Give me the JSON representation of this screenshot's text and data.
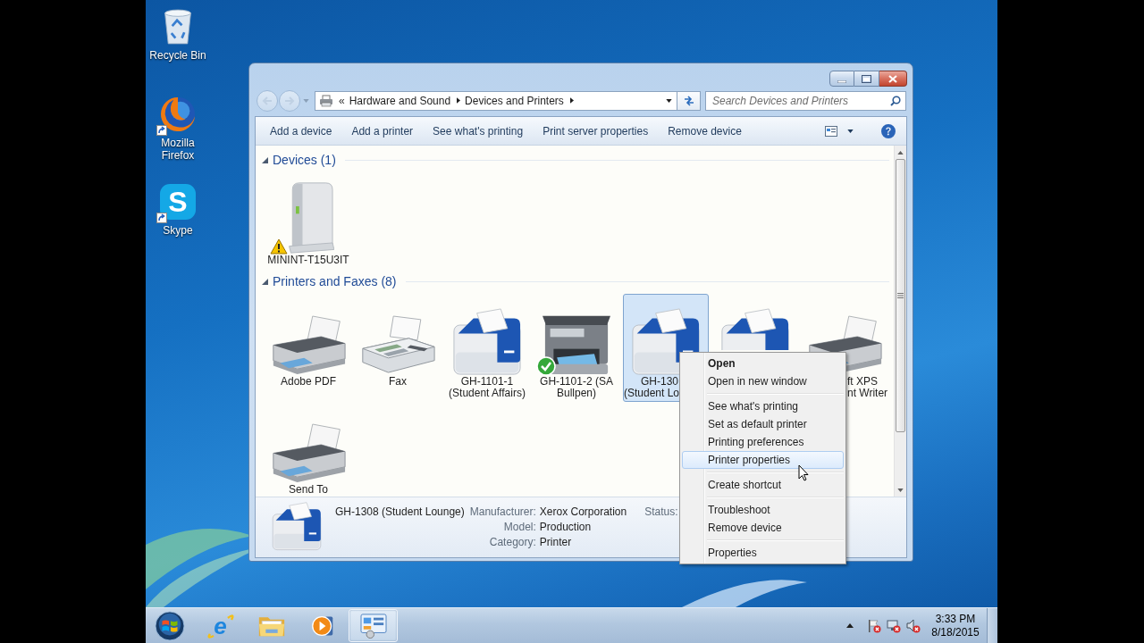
{
  "desktop_icons": [
    {
      "kind": "recycle-bin",
      "label": [
        "Recycle Bin"
      ],
      "shortcut": false
    },
    {
      "kind": "globe",
      "label": [
        "Mozilla",
        "Firefox"
      ],
      "shortcut": true
    },
    {
      "kind": "letter-tile",
      "glyph": "S",
      "label": [
        "Skype"
      ],
      "shortcut": true
    }
  ],
  "window": {
    "back": {
      "disabled": true
    },
    "forward": {
      "disabled": true
    },
    "address": {
      "overflow": "«",
      "crumbs": [
        "Hardware and Sound",
        "Devices and Printers"
      ]
    },
    "search": {
      "placeholder": "Search Devices and Printers"
    },
    "commands": [
      "Add a device",
      "Add a printer",
      "See what's printing",
      "Print server properties",
      "Remove device"
    ],
    "groups": [
      {
        "title": "Devices (1)",
        "expanded": true,
        "items": [
          {
            "kind": "tower",
            "label": [
              "MININT-T15U3IT"
            ],
            "selected": false,
            "warning": true,
            "default": false
          }
        ]
      },
      {
        "title": "Printers and Faxes (8)",
        "expanded": true,
        "items": [
          {
            "kind": "inkjet",
            "label": [
              "Adobe PDF"
            ],
            "selected": false,
            "warning": false,
            "default": false
          },
          {
            "kind": "fax",
            "label": [
              "Fax"
            ],
            "selected": false,
            "warning": false,
            "default": false
          },
          {
            "kind": "laser",
            "label": [
              "GH-1101-1",
              "(Student Affairs)"
            ],
            "selected": false,
            "warning": false,
            "default": false
          },
          {
            "kind": "multifunction",
            "label": [
              "GH-1101-2 (SA",
              "Bullpen)"
            ],
            "selected": false,
            "warning": false,
            "default": true
          },
          {
            "kind": "laser",
            "label": [
              "GH-130",
              "(Student Lo"
            ],
            "selected": true,
            "warning": false,
            "default": false
          },
          {
            "kind": "laser",
            "selected": false,
            "warning": false,
            "default": false
          },
          {
            "kind": "inkjet",
            "label": [
              "ft XPS",
              "nt Writer"
            ],
            "selected": false,
            "warning": false,
            "default": false
          },
          {
            "kind": "inkjet",
            "label": [
              "Send To"
            ],
            "selected": false,
            "warning": false,
            "default": false
          }
        ]
      }
    ],
    "details": {
      "kind": "laser",
      "name": "GH-1308 (Student Lounge)",
      "fields": [
        {
          "label": "Manufacturer:",
          "value": "Xerox Corporation"
        },
        {
          "label": "Model:",
          "value": "Production"
        },
        {
          "label": "Category:",
          "value": "Printer"
        }
      ],
      "status": {
        "label": "Status:"
      }
    }
  },
  "context_menu": [
    {
      "kind": "item",
      "label": "Open",
      "default": true,
      "highlighted": false
    },
    {
      "kind": "item",
      "label": "Open in new window",
      "default": false,
      "highlighted": false
    },
    {
      "kind": "separator"
    },
    {
      "kind": "item",
      "label": "See what's printing",
      "default": false,
      "highlighted": false
    },
    {
      "kind": "item",
      "label": "Set as default printer",
      "default": false,
      "highlighted": false
    },
    {
      "kind": "item",
      "label": "Printing preferences",
      "default": false,
      "highlighted": false
    },
    {
      "kind": "item",
      "label": "Printer properties",
      "default": false,
      "highlighted": true
    },
    {
      "kind": "separator"
    },
    {
      "kind": "item",
      "label": "Create shortcut",
      "default": false,
      "highlighted": false
    },
    {
      "kind": "separator"
    },
    {
      "kind": "item",
      "label": "Troubleshoot",
      "default": false,
      "highlighted": false
    },
    {
      "kind": "item",
      "label": "Remove device",
      "default": false,
      "highlighted": false
    },
    {
      "kind": "separator"
    },
    {
      "kind": "item",
      "label": "Properties",
      "default": false,
      "highlighted": false
    }
  ],
  "taskbar": {
    "apps": [
      {
        "kind": "browser",
        "glyph": "e",
        "active": false
      },
      {
        "kind": "folder",
        "active": false
      },
      {
        "kind": "media",
        "active": false
      },
      {
        "kind": "control-panel",
        "active": true
      }
    ],
    "clock": {
      "time": "3:33 PM",
      "date": "8/18/2015"
    }
  }
}
